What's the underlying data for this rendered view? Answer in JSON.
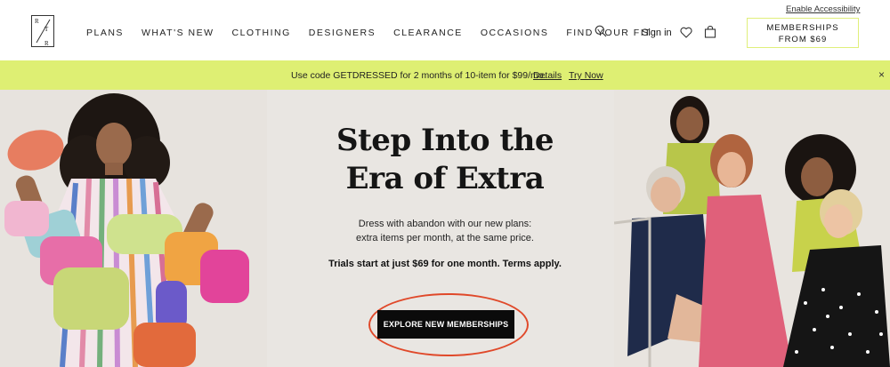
{
  "header": {
    "logo_letters": [
      "R",
      "T",
      "R"
    ],
    "nav": [
      "PLANS",
      "WHAT'S NEW",
      "CLOTHING",
      "DESIGNERS",
      "CLEARANCE",
      "OCCASIONS",
      "FIND YOUR FIT"
    ],
    "sign_in": "Sign in",
    "accessibility": "Enable Accessibility",
    "membership_line1": "MEMBERSHIPS",
    "membership_line2": "FROM $69",
    "icons": [
      "search-icon",
      "heart-icon",
      "bag-icon"
    ]
  },
  "promo": {
    "text": "Use code GETDRESSED for 2 months of 10-item for $99/mo.",
    "details": "Details",
    "try_now": "Try Now",
    "close": "×",
    "background": "#deef73"
  },
  "hero": {
    "title_line1": "Step Into the",
    "title_line2": "Era of Extra",
    "subtitle_line1": "Dress with abandon with our new plans:",
    "subtitle_line2": "extra items per month, at the same price.",
    "trial": "Trials start at just $69 for one month. Terms apply.",
    "cta": "EXPLORE NEW MEMBERSHIPS",
    "cta_highlight_color": "#e0492a"
  }
}
